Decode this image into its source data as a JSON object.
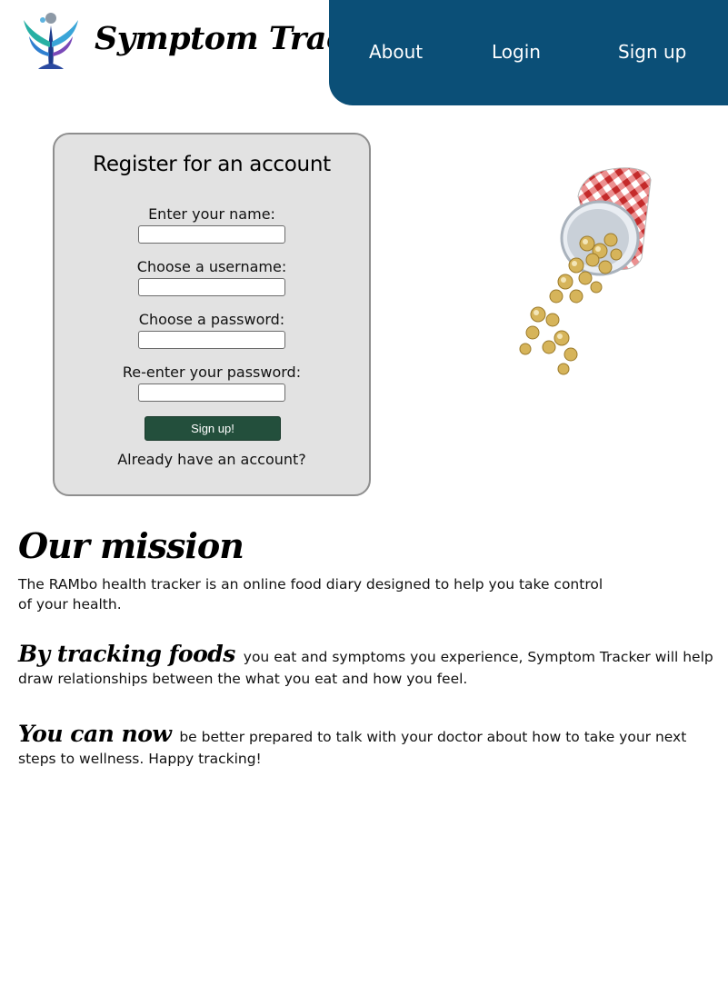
{
  "header": {
    "site_title": "Symptom Tracker",
    "nav": {
      "about": "About",
      "login": "Login",
      "signup": "Sign up"
    },
    "colors": {
      "nav_background": "#0b4f77",
      "nav_text": "#ffffff"
    }
  },
  "register": {
    "title": "Register for an account",
    "fields": {
      "name": {
        "label": "Enter your name:",
        "value": ""
      },
      "username": {
        "label": "Choose a username:",
        "value": ""
      },
      "password": {
        "label": "Choose a password:",
        "value": ""
      },
      "password_confirm": {
        "label": "Re-enter your password:",
        "value": ""
      }
    },
    "submit_label": "Sign up!",
    "already_link": "Already have an account?",
    "colors": {
      "panel_background": "#e2e2e2",
      "button_background": "#234f3c"
    }
  },
  "mission": {
    "title": "Our mission",
    "intro": "The RAMbo health tracker is an online food diary designed to help you take control of your health.",
    "paragraph_1": {
      "lead": "By tracking foods",
      "text": "you eat and symptoms you experience, Symptom Tracker will help draw relationships between the what you eat and how you feel."
    },
    "paragraph_2": {
      "lead": "You can now",
      "text": "be better prepared to talk with your doctor about how to take your next steps to wellness. Happy tracking!"
    }
  },
  "icons": {
    "logo": "person-figure-logo-icon",
    "illustration": "popcorn-cup-illustration"
  }
}
